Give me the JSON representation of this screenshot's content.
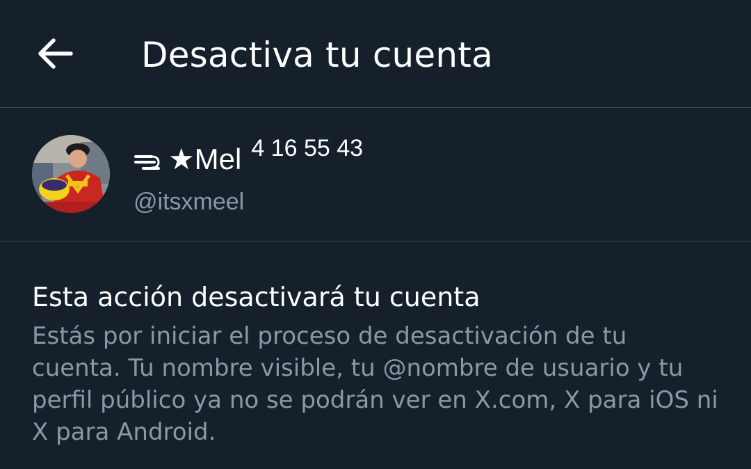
{
  "header": {
    "back_icon": "arrow-left-icon",
    "title": "Desactiva tu cuenta"
  },
  "profile": {
    "display_name": "★Mel",
    "display_name_suffix": "4 16 55 43",
    "handle": "@itsxmeel"
  },
  "content": {
    "title": "Esta acción desactivará tu cuenta",
    "body": "Estás por iniciar el proceso de desactivación de tu cuenta. Tu nombre visible, tu @nombre de usuario y tu perfil público ya no se podrán ver en X.com, X para iOS ni X para Android."
  },
  "colors": {
    "background": "#15202b",
    "divider": "#38444d",
    "primary_text": "#ffffff",
    "secondary_text": "#8b98a5"
  }
}
